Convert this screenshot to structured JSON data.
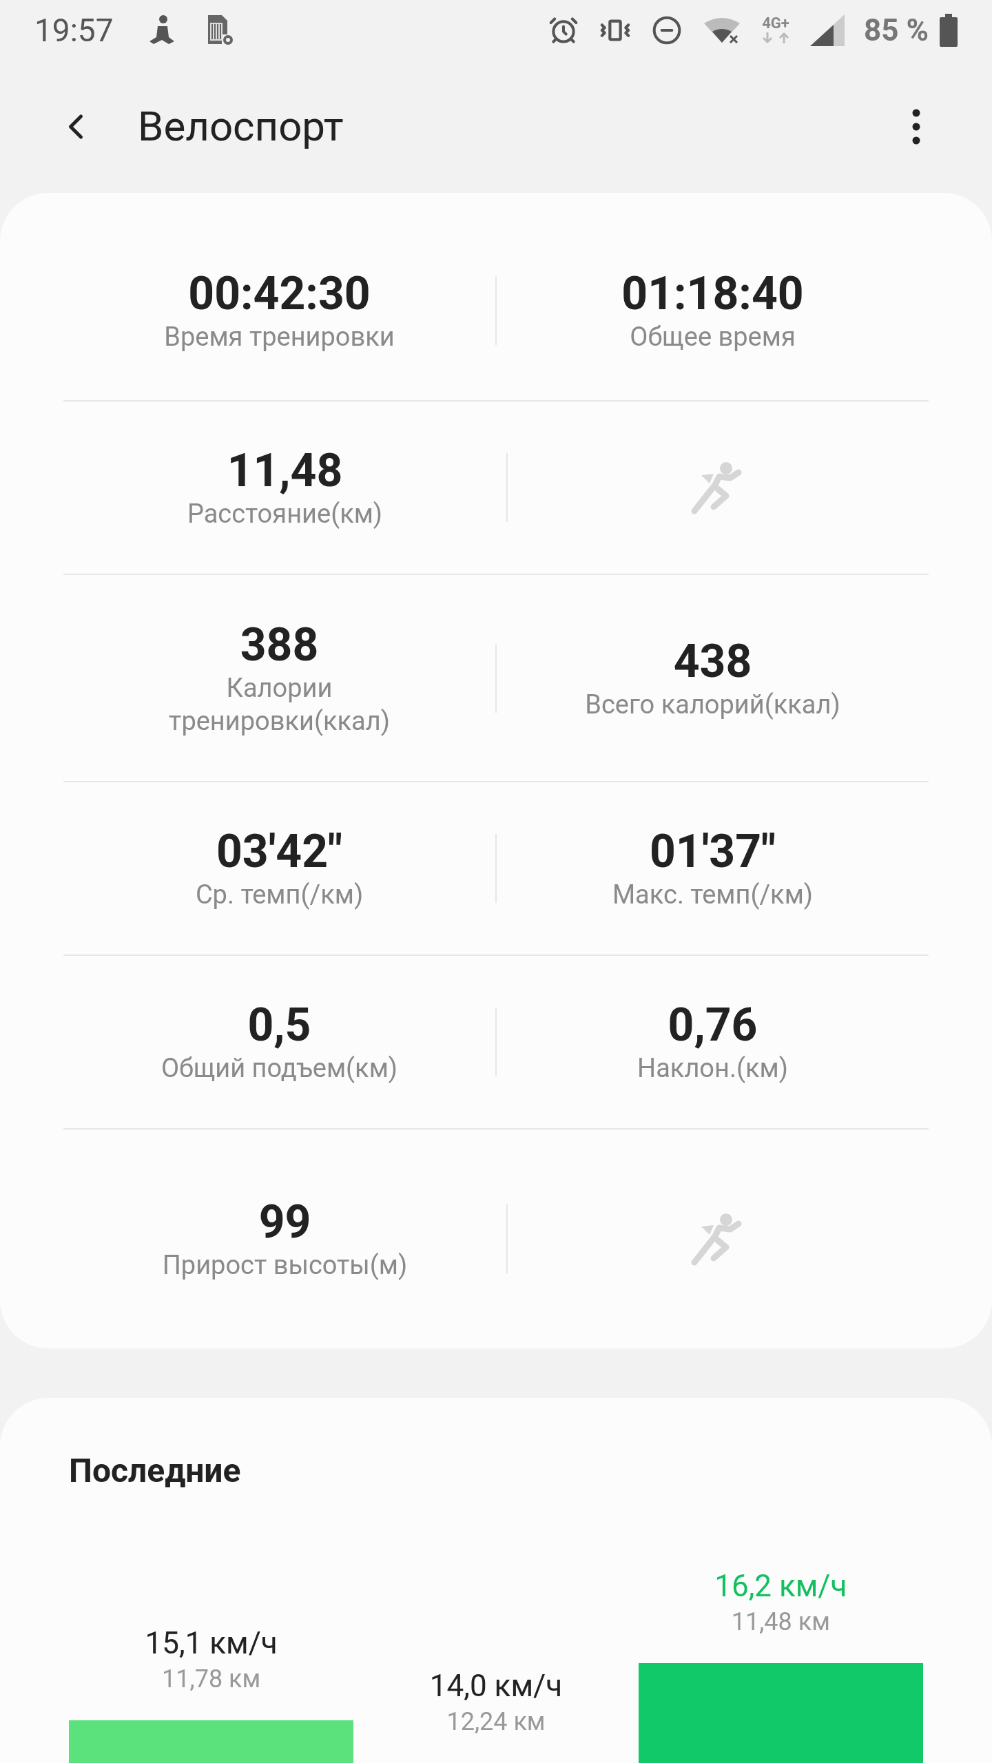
{
  "status_bar": {
    "time": "19:57",
    "network": "4G+",
    "battery": "85 %"
  },
  "header": {
    "title": "Велоспорт"
  },
  "stats": [
    {
      "cells": [
        {
          "kind": "stat",
          "value": "00:42:30",
          "label": "Время тренировки"
        },
        {
          "kind": "stat",
          "value": "01:18:40",
          "label": "Общее время"
        }
      ]
    },
    {
      "cells": [
        {
          "kind": "stat",
          "value": "11,48",
          "label": "Расстояние(км)"
        },
        {
          "kind": "icon"
        }
      ]
    },
    {
      "cells": [
        {
          "kind": "stat",
          "value": "388",
          "label": "Калории тренировки(ккал)"
        },
        {
          "kind": "stat",
          "value": "438",
          "label": "Всего калорий(ккал)"
        }
      ]
    },
    {
      "cells": [
        {
          "kind": "stat",
          "value": "03'42\"",
          "label": "Ср. темп(/км)"
        },
        {
          "kind": "stat",
          "value": "01'37\"",
          "label": "Макс. темп(/км)"
        }
      ]
    },
    {
      "cells": [
        {
          "kind": "stat",
          "value": "0,5",
          "label": "Общий подъем(км)"
        },
        {
          "kind": "stat",
          "value": "0,76",
          "label": "Наклон.(км)"
        }
      ]
    },
    {
      "cells": [
        {
          "kind": "stat",
          "value": "99",
          "label": "Прирост высоты(м)"
        },
        {
          "kind": "icon"
        }
      ]
    }
  ],
  "recent": {
    "title": "Последние",
    "bars": [
      {
        "speed": "15,1 км/ч",
        "distance": "11,78 км",
        "selected": false,
        "color": "#5ce27d"
      },
      {
        "speed": "14,0 км/ч",
        "distance": "12,24 км",
        "selected": false
      },
      {
        "speed": "16,2 км/ч",
        "distance": "11,48 км",
        "selected": true,
        "color": "#12c96a"
      }
    ]
  }
}
